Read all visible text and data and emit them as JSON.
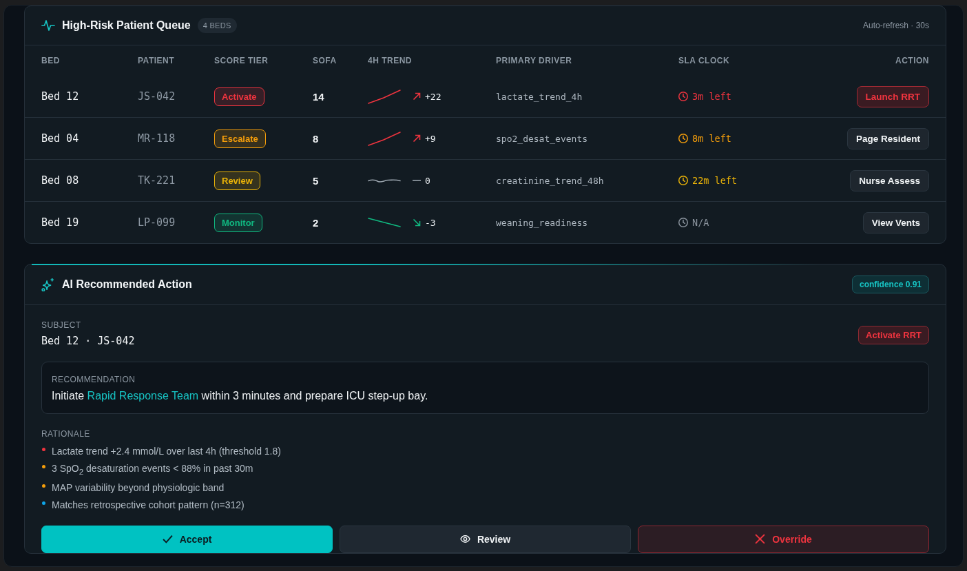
{
  "queue": {
    "title": "High-Risk Patient Queue",
    "count": "4 BEDS",
    "refresh": "Auto-refresh · 30s",
    "columns": [
      "BED",
      "PATIENT",
      "SCORE TIER",
      "SOFA",
      "4H TREND",
      "PRIMARY DRIVER",
      "SLA CLOCK",
      "ACTION"
    ],
    "rows": [
      {
        "bed": "Bed 12",
        "patient": "JS-042",
        "tier": {
          "label": "Activate",
          "color": "#f0343f"
        },
        "sofa": "14",
        "trend": {
          "kind": "up",
          "delta": "+22"
        },
        "driver": "lactate_trend_4h",
        "sla": {
          "text": "3m left",
          "color": "#f0343f"
        },
        "action": {
          "label": "Launch RRT",
          "kind": "danger"
        }
      },
      {
        "bed": "Bed 04",
        "patient": "MR-118",
        "tier": {
          "label": "Escalate",
          "color": "#f59e0b"
        },
        "sofa": "8",
        "trend": {
          "kind": "up",
          "delta": "+9"
        },
        "driver": "spo2_desat_events",
        "sla": {
          "text": "8m left",
          "color": "#f59e0b"
        },
        "action": {
          "label": "Page Resident",
          "kind": "default"
        }
      },
      {
        "bed": "Bed 08",
        "patient": "TK-221",
        "tier": {
          "label": "Review",
          "color": "#eab308"
        },
        "sofa": "5",
        "trend": {
          "kind": "flat",
          "delta": "0"
        },
        "driver": "creatinine_trend_48h",
        "sla": {
          "text": "22m left",
          "color": "#eab308"
        },
        "action": {
          "label": "Nurse Assess",
          "kind": "default"
        }
      },
      {
        "bed": "Bed 19",
        "patient": "LP-099",
        "tier": {
          "label": "Monitor",
          "color": "#10b981"
        },
        "sofa": "2",
        "trend": {
          "kind": "down",
          "delta": "-3"
        },
        "driver": "weaning_readiness",
        "sla": {
          "text": "N/A",
          "color": "#8b949e"
        },
        "action": {
          "label": "View Vents",
          "kind": "default"
        }
      }
    ]
  },
  "recommendation_card": {
    "title": "AI Recommended Action",
    "confidence": "confidence 0.91",
    "subject_label": "SUBJECT",
    "subject": "Bed 12 · JS-042",
    "action_badge": "Activate RRT",
    "recommendation": {
      "label": "RECOMMENDATION",
      "parts": [
        {
          "text": "Initiate ",
          "highlight": false
        },
        {
          "text": "Rapid Response Team",
          "highlight": true
        },
        {
          "text": " within 3 minutes and prepare ICU step-up bay.",
          "highlight": false
        }
      ]
    },
    "rationale": {
      "label": "RATIONALE",
      "items": [
        {
          "text": "Lactate trend +2.4 mmol/L over last 4h (threshold 1.8)",
          "color": "#f0343f"
        },
        {
          "text": "3 SpO$_{2}$ desaturation events < 88% in past 30m",
          "color": "#f59e0b"
        },
        {
          "text": "MAP variability beyond physiologic band",
          "color": "#f59e0b"
        },
        {
          "text": "Matches retrospective cohort pattern (n=312)",
          "color": "#0ea5e9"
        }
      ]
    },
    "buttons": [
      {
        "label": "Accept",
        "kind": "primary"
      },
      {
        "label": "Review",
        "kind": "secondary"
      },
      {
        "label": "Override",
        "kind": "danger"
      }
    ]
  }
}
